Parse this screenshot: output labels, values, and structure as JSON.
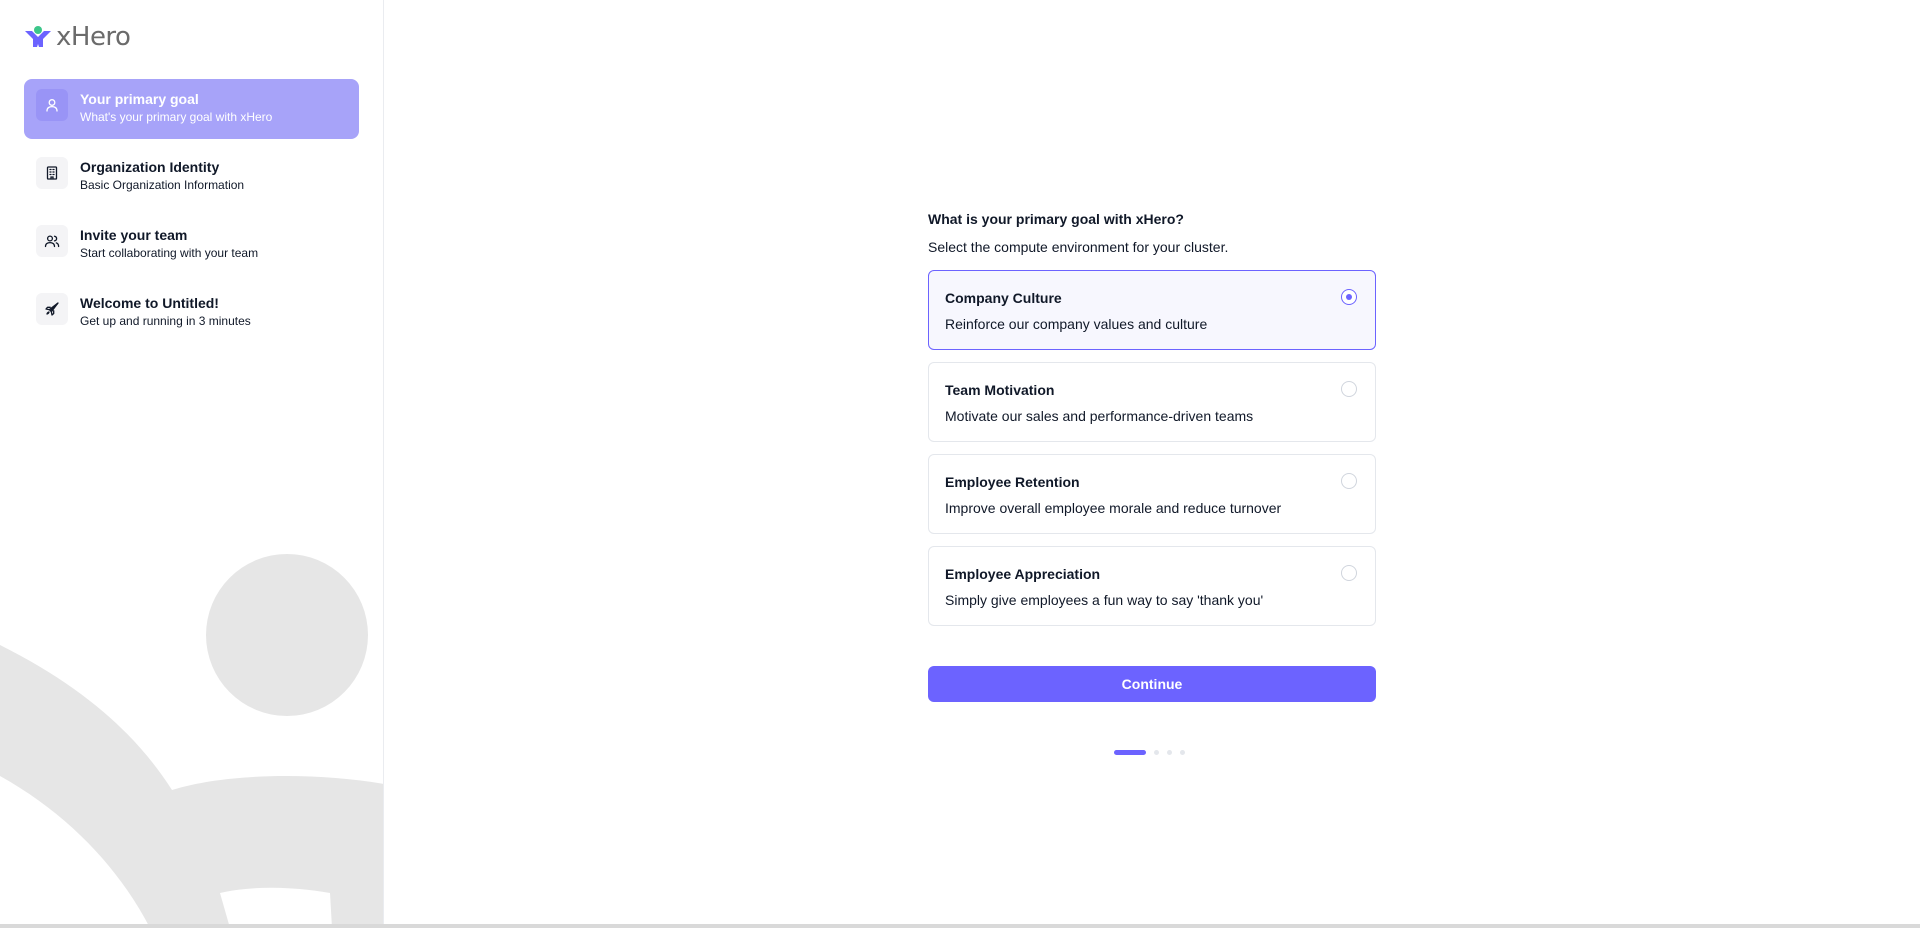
{
  "brand": {
    "name": "xHero",
    "icon": "xhero-logo-icon",
    "accent": "#6c63ff",
    "logo_green": "#3cc68a"
  },
  "sidebar": {
    "steps": [
      {
        "title": "Your primary goal",
        "subtitle": "What's your primary goal with xHero",
        "icon": "user-icon",
        "active": true
      },
      {
        "title": "Organization Identity",
        "subtitle": "Basic Organization Information",
        "icon": "building-icon",
        "active": false
      },
      {
        "title": "Invite your team",
        "subtitle": "Start collaborating with your team",
        "icon": "users-icon",
        "active": false
      },
      {
        "title": "Welcome to Untitled!",
        "subtitle": "Get up and running in 3 minutes",
        "icon": "rocket-icon",
        "active": false
      }
    ]
  },
  "main": {
    "question": "What is your primary goal with xHero?",
    "subtitle": "Select the compute environment for your cluster.",
    "options": [
      {
        "title": "Company Culture",
        "description": "Reinforce our company values and culture",
        "selected": true
      },
      {
        "title": "Team Motivation",
        "description": "Motivate our sales and performance-driven teams",
        "selected": false
      },
      {
        "title": "Employee Retention",
        "description": "Improve overall employee morale and reduce turnover",
        "selected": false
      },
      {
        "title": "Employee Appreciation",
        "description": "Simply give employees a fun way to say 'thank you'",
        "selected": false
      }
    ],
    "continue_label": "Continue",
    "pagination": {
      "current": 1,
      "total": 4
    }
  }
}
